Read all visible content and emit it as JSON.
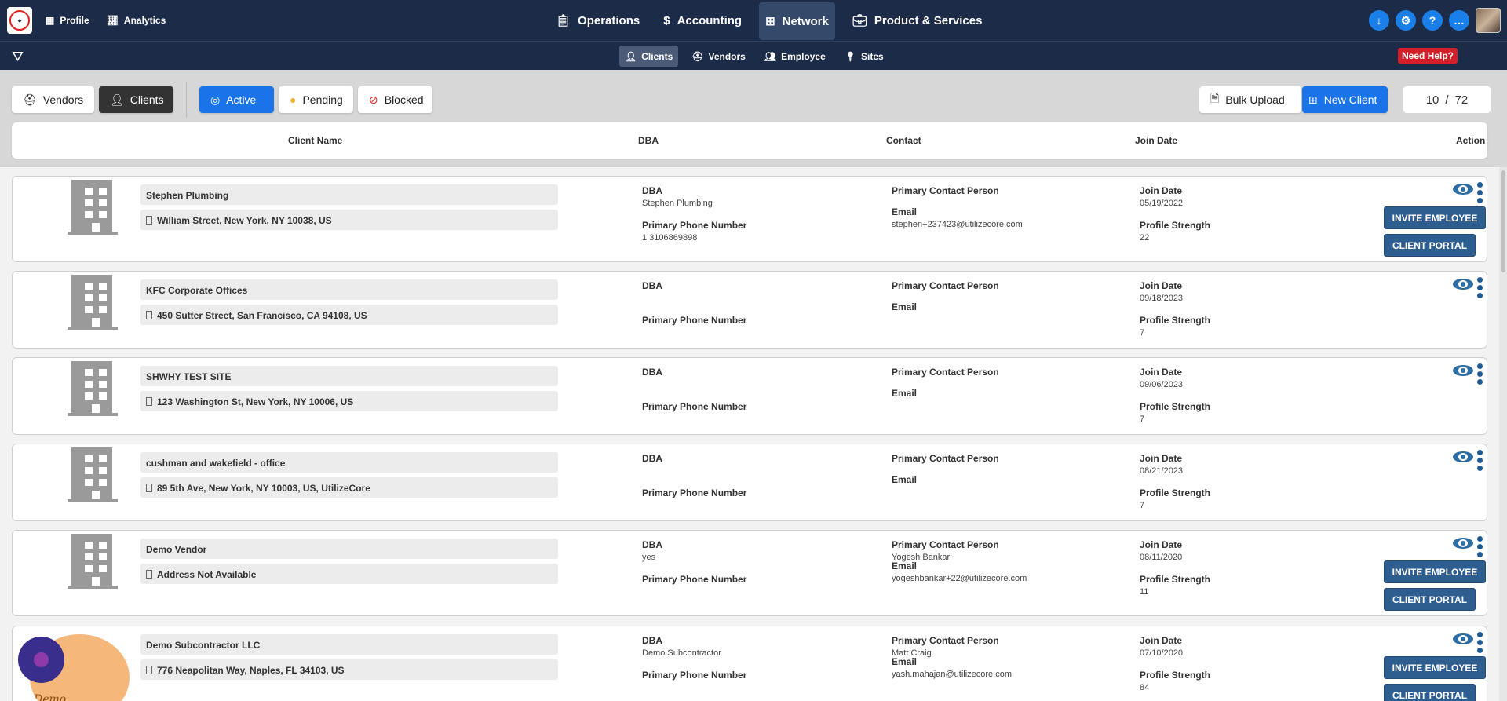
{
  "topnav": {
    "left": [
      {
        "icon": "building-icon",
        "label": "Profile"
      },
      {
        "icon": "chart-line-icon",
        "label": "Analytics"
      }
    ],
    "center": [
      {
        "icon": "clipboard-icon",
        "label": "Operations"
      },
      {
        "icon": "money-icon",
        "label": "Accounting"
      },
      {
        "icon": "network-icon",
        "label": "Network"
      },
      {
        "icon": "briefcase-icon",
        "label": "Product & Services"
      }
    ],
    "right_icons": [
      "download-icon",
      "gear-icon",
      "question-icon",
      "chat-icon"
    ]
  },
  "subnav": {
    "items": [
      {
        "icon": "user-tie-icon",
        "label": "Clients"
      },
      {
        "icon": "hard-hat-icon",
        "label": "Vendors"
      },
      {
        "icon": "users-icon",
        "label": "Employee"
      },
      {
        "icon": "map-pin-icon",
        "label": "Sites"
      }
    ],
    "help": "Need Help?"
  },
  "toolbar": {
    "vendors": "Vendors",
    "clients": "Clients",
    "active": "Active",
    "pending": "Pending",
    "blocked": "Blocked",
    "bulk_upload": "Bulk Upload",
    "new_client": "New Client",
    "pager_current": "10",
    "pager_sep": "/",
    "pager_total": "72"
  },
  "columns": {
    "name": "Client Name",
    "dba": "DBA",
    "contact": "Contact",
    "join": "Join Date",
    "action": "Action"
  },
  "labels": {
    "dba": "DBA",
    "phone": "Primary Phone Number",
    "contact": "Primary Contact Person",
    "email": "Email",
    "join": "Join Date",
    "strength": "Profile Strength",
    "invite": "INVITE EMPLOYEE",
    "portal": "CLIENT PORTAL"
  },
  "clients": [
    {
      "name": "Stephen Plumbing",
      "address": "William Street, New York, NY 10038, US",
      "dba": "Stephen Plumbing",
      "phone": "1 3106869898",
      "contact": "",
      "email": "stephen+237423@utilizecore.com",
      "join": "05/19/2022",
      "strength": "22"
    },
    {
      "name": "KFC Corporate Offices",
      "address": "450 Sutter Street, San Francisco, CA 94108, US",
      "dba": "",
      "phone": "",
      "contact": "",
      "email": "",
      "join": "09/18/2023",
      "strength": "7"
    },
    {
      "name": "SHWHY TEST SITE",
      "address": "123 Washington St, New York, NY 10006, US",
      "dba": "",
      "phone": "",
      "contact": "",
      "email": "",
      "join": "09/06/2023",
      "strength": "7"
    },
    {
      "name": "cushman and wakefield - office",
      "address": "89 5th Ave, New York, NY 10003, US, UtilizeCore",
      "dba": "",
      "phone": "",
      "contact": "",
      "email": "",
      "join": "08/21/2023",
      "strength": "7"
    },
    {
      "name": "Demo Vendor",
      "address": "Address Not Available",
      "dba": "yes",
      "phone": "",
      "contact": "Yogesh Bankar",
      "email": "yogeshbankar+22@utilizecore.com",
      "join": "08/11/2020",
      "strength": "11"
    },
    {
      "name": "Demo Subcontractor LLC",
      "address": "776 Neapolitan Way, Naples, FL 34103, US",
      "dba": "Demo Subcontractor",
      "phone": "",
      "contact": "Matt Craig",
      "email": "yash.mahajan@utilizecore.com",
      "join": "07/10/2020",
      "strength": "84",
      "logo_text": "Demo Subcontractor LLC"
    }
  ]
}
